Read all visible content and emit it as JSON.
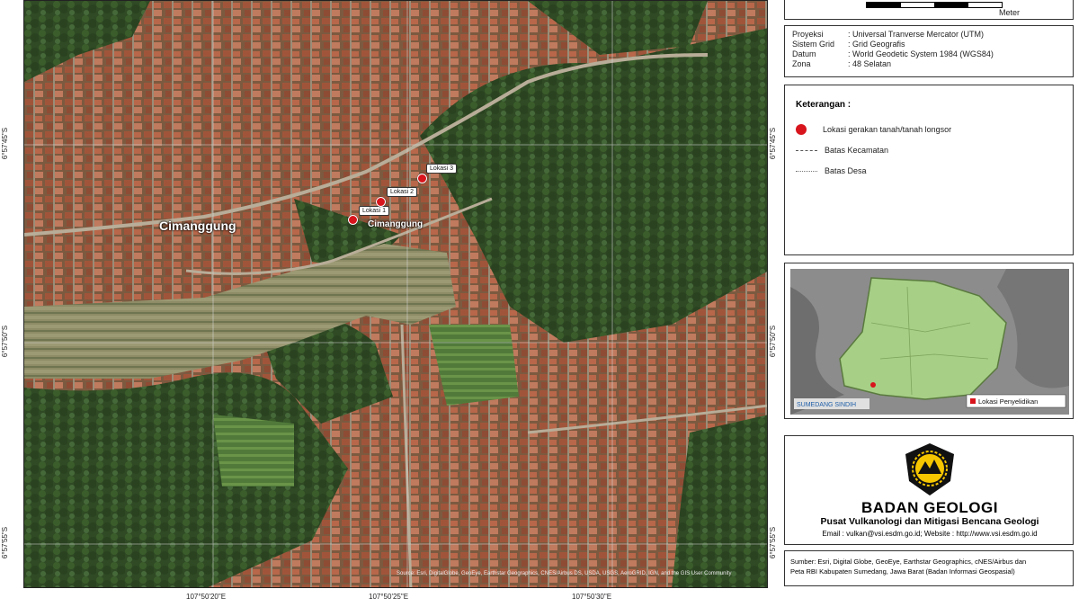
{
  "map": {
    "place_main": "Cimanggung",
    "place_small": "Cimanggung",
    "markers": [
      {
        "label": "Lokasi 1"
      },
      {
        "label": "Lokasi 2"
      },
      {
        "label": "Lokasi 3"
      }
    ],
    "credits": "Source: Esri, DigitalGlobe, GeoEye, Earthstar Geographics, CNES/Airbus DS, USDA, USGS, AeroGRID, IGN, and the GIS User Community",
    "x_ticks": [
      "107°50'20\"E",
      "107°50'25\"E",
      "107°50'30\"E"
    ],
    "y_ticks_left": [
      "6°57'45\"S",
      "6°57'50\"S",
      "6°57'55\"S"
    ],
    "y_ticks_right": [
      "6°57'45\"S",
      "6°57'50\"S",
      "6°57'55\"S"
    ]
  },
  "scale": {
    "unit": "Meter"
  },
  "projection": {
    "rows": [
      {
        "key": "Proyeksi",
        "value": ": Universal Tranverse Mercator (UTM)"
      },
      {
        "key": "Sistem Grid",
        "value": ": Grid Geografis"
      },
      {
        "key": "Datum",
        "value": ": World Geodetic System 1984 (WGS84)"
      },
      {
        "key": "Zona",
        "value": ": 48 Selatan"
      }
    ]
  },
  "legend": {
    "title": "Keterangan :",
    "items": [
      {
        "label": "Lokasi gerakan tanah/tanah longsor"
      },
      {
        "label": "Batas Kecamatan"
      },
      {
        "label": "Batas Desa"
      }
    ]
  },
  "inset": {
    "label": "Lokasi Penyelidikan",
    "district": "SUMEDANG SINDIH"
  },
  "logo": {
    "agency": "BADAN GEOLOGI",
    "center": "Pusat Vulkanologi dan Mitigasi Bencana Geologi",
    "contact": "Email : vulkan@vsi.esdm.go.id; Website : http://www.vsi.esdm.go.id"
  },
  "sources": {
    "line1": "Sumber: Esri, Digital Globe, GeoEye, Earthstar Geographics, cNES/Airbus dan",
    "line2": "Peta RBI Kabupaten Sumedang, Jawa Barat (Badan Informasi Geospasial)"
  },
  "colors": {
    "marker": "#d8141c",
    "inset_fill": "#a7cf86",
    "logo_yellow": "#f5c500"
  }
}
